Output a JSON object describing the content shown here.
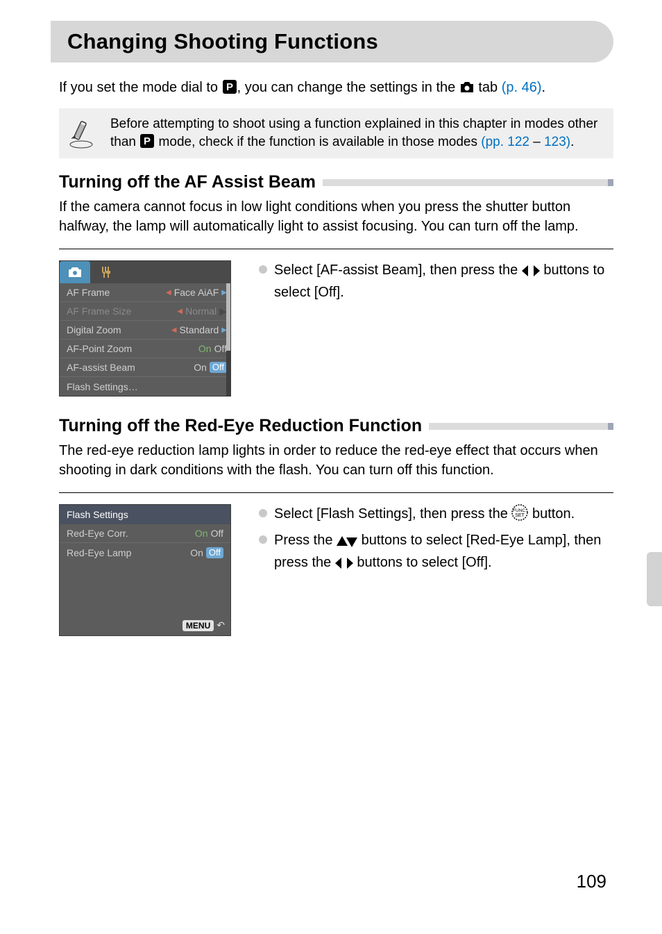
{
  "page": {
    "title": "Changing Shooting Functions",
    "intro_a": "If you set the mode dial to ",
    "intro_b": ", you can change the settings in the ",
    "intro_c": " tab ",
    "intro_link": "(p. 46)",
    "intro_d": ".",
    "note_a": "Before attempting to shoot using a function explained in this chapter in modes other than ",
    "note_b": " mode, check if the function is available in those modes ",
    "note_link1": "(pp. 122",
    "note_dash": " – ",
    "note_link2": "123)",
    "note_c": ".",
    "page_number": "109"
  },
  "section1": {
    "heading": "Turning off the AF Assist Beam",
    "body": "If the camera cannot focus in low light conditions when you press the shutter button halfway, the lamp will automatically light to assist focusing. You can turn off the lamp.",
    "instr_a": "Select [AF-assist Beam], then press the ",
    "instr_b": " buttons to select [Off].",
    "menu": {
      "items": [
        {
          "label": "AF Frame",
          "value": "Face AiAF",
          "disabled": false,
          "arrows": true
        },
        {
          "label": "AF Frame Size",
          "value": "Normal",
          "disabled": true,
          "arrows": true
        },
        {
          "label": "Digital Zoom",
          "value": "Standard",
          "disabled": false,
          "arrows": true
        },
        {
          "label": "AF-Point Zoom",
          "on": "On",
          "off": "Off",
          "disabled": false,
          "toggle": true,
          "selected": "on_plain"
        },
        {
          "label": "AF-assist Beam",
          "on": "On",
          "off": "Off",
          "disabled": false,
          "toggle": true,
          "selected": "off"
        },
        {
          "label": "Flash Settings…",
          "value": "",
          "disabled": false
        }
      ]
    }
  },
  "section2": {
    "heading": "Turning off the Red-Eye Reduction Function",
    "body": "The red-eye reduction lamp lights in order to reduce the red-eye effect that occurs when shooting in dark conditions with the flash. You can turn off this function.",
    "instr1_a": "Select [Flash Settings], then press the ",
    "instr1_b": " button.",
    "instr2_a": "Press the ",
    "instr2_b": " buttons to select [Red-Eye Lamp], then press the ",
    "instr2_c": " buttons to select [Off].",
    "menu": {
      "title": "Flash Settings",
      "items": [
        {
          "label": "Red-Eye Corr.",
          "on": "On",
          "off": "Off",
          "selected": "on_plain"
        },
        {
          "label": "Red-Eye Lamp",
          "on": "On",
          "off": "Off",
          "selected": "off"
        }
      ],
      "back": "MENU"
    }
  }
}
